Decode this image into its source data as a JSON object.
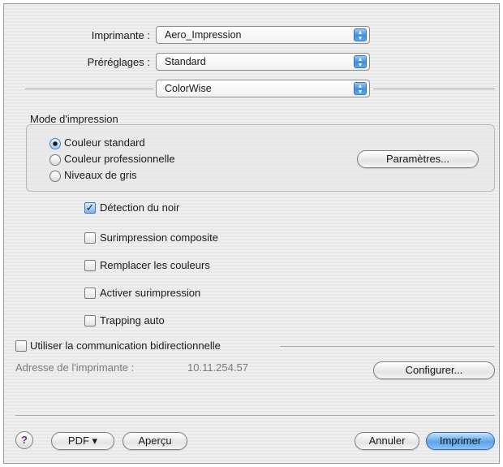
{
  "printer": {
    "label": "Imprimante :",
    "value": "Aero_Impression"
  },
  "presets": {
    "label": "Préréglages :",
    "value": "Standard"
  },
  "panel_select": {
    "value": "ColorWise"
  },
  "print_mode": {
    "title": "Mode d'impression",
    "options": [
      "Couleur standard",
      "Couleur professionnelle",
      "Niveaux de gris"
    ],
    "selected": "Couleur standard",
    "settings_button": "Paramètres..."
  },
  "options": [
    {
      "label": "Détection du noir",
      "checked": true
    },
    {
      "label": "Surimpression composite",
      "checked": false
    },
    {
      "label": "Remplacer les couleurs",
      "checked": false
    },
    {
      "label": "Activer surimpression",
      "checked": false
    },
    {
      "label": "Trapping auto",
      "checked": false
    }
  ],
  "bidirectional": {
    "label": "Utiliser la communication bidirectionnelle",
    "checked": false,
    "address_label": "Adresse de l'imprimante :",
    "address_value": "10.11.254.57",
    "configure_button": "Configurer..."
  },
  "footer": {
    "help": "?",
    "pdf": "PDF ▾",
    "preview": "Aperçu",
    "cancel": "Annuler",
    "print": "Imprimer"
  },
  "colors": {
    "accent": "#5aa5ec",
    "window_bg": "#ececec"
  },
  "icons": {
    "popup_arrows": "up-down-arrows-icon",
    "radio_selected": "radio-dot-icon",
    "checkmark": "checkmark-icon"
  }
}
